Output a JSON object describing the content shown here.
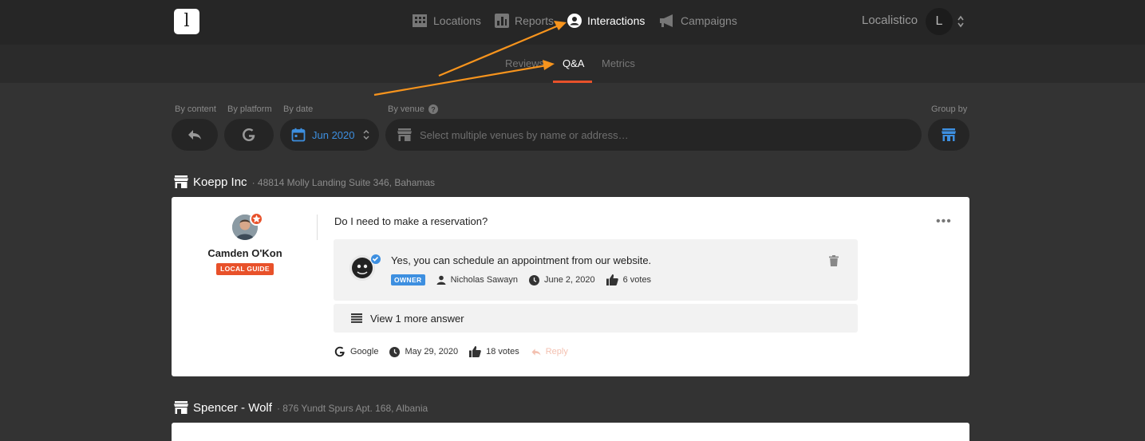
{
  "header": {
    "logo_letter": "l",
    "nav": [
      {
        "label": "Locations",
        "icon": "building-icon",
        "active": false
      },
      {
        "label": "Reports",
        "icon": "chart-icon",
        "active": false
      },
      {
        "label": "Interactions",
        "icon": "user-circle-icon",
        "active": true
      },
      {
        "label": "Campaigns",
        "icon": "megaphone-icon",
        "active": false
      }
    ],
    "account_name": "Localistico",
    "account_initial": "L"
  },
  "subnav": {
    "tabs": [
      "Reviews",
      "Q&A",
      "Metrics"
    ],
    "active_tab": "Q&A"
  },
  "filters": {
    "by_content_label": "By content",
    "by_platform_label": "By platform",
    "by_date_label": "By date",
    "date_value": "Jun 2020",
    "by_venue_label": "By venue",
    "venue_placeholder": "Select multiple venues by name or address…",
    "group_by_label": "Group by"
  },
  "groups": [
    {
      "name": "Koepp Inc",
      "address": "· 48814 Molly Landing Suite 346, Bahamas",
      "question": {
        "author": "Camden O'Kon",
        "author_badge": "LOCAL GUIDE",
        "text": "Do I need to make a reservation?",
        "platform": "Google",
        "date": "May 29, 2020",
        "votes": "18 votes",
        "reply_label": "Reply",
        "answer": {
          "text": "Yes, you can schedule an appointment from our website.",
          "badge": "OWNER",
          "author": "Nicholas Sawayn",
          "date": "June 2, 2020",
          "votes": "6 votes"
        },
        "more_answers_label": "View 1 more answer"
      }
    },
    {
      "name": "Spencer - Wolf",
      "address": "· 876 Yundt Spurs Apt. 168, Albania"
    }
  ],
  "colors": {
    "accent": "#e8512a",
    "link_blue": "#3d8fe0",
    "annotation_arrow": "#f7941d"
  }
}
